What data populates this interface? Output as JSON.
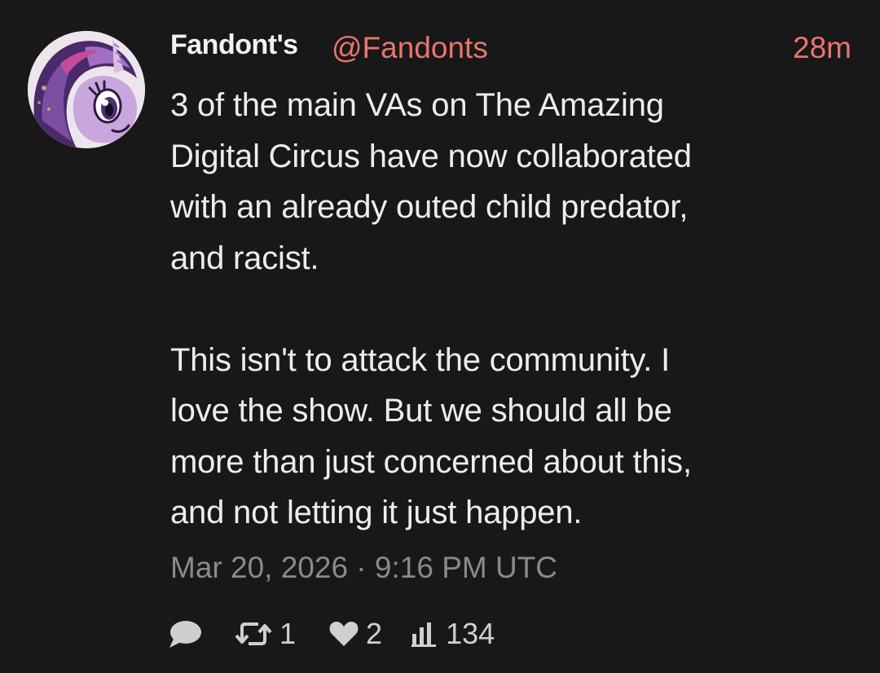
{
  "tweet": {
    "author": {
      "display_name": "Fandont's",
      "handle": "@Fandonts",
      "avatar_icon": "pony-avatar-icon"
    },
    "time_ago": "28m",
    "body_lines": [
      [
        "3 of the main VAs on The Amazing",
        "Digital Circus have now collaborated",
        "with an already outed child predator,",
        "and racist."
      ],
      [
        "This isn't to attack the community. I",
        "love the show. But we should all be",
        "more than just concerned about this,",
        "and not letting it just happen."
      ]
    ],
    "timestamp": "Mar 20, 2026 · 9:16 PM UTC",
    "stats": {
      "replies": "",
      "retweets": "1",
      "likes": "2",
      "views": "134"
    }
  },
  "colors": {
    "background": "#181818",
    "text": "#ededed",
    "accent": "#e8756e",
    "muted": "#8a8a8a",
    "icon": "#cfcfcf"
  }
}
